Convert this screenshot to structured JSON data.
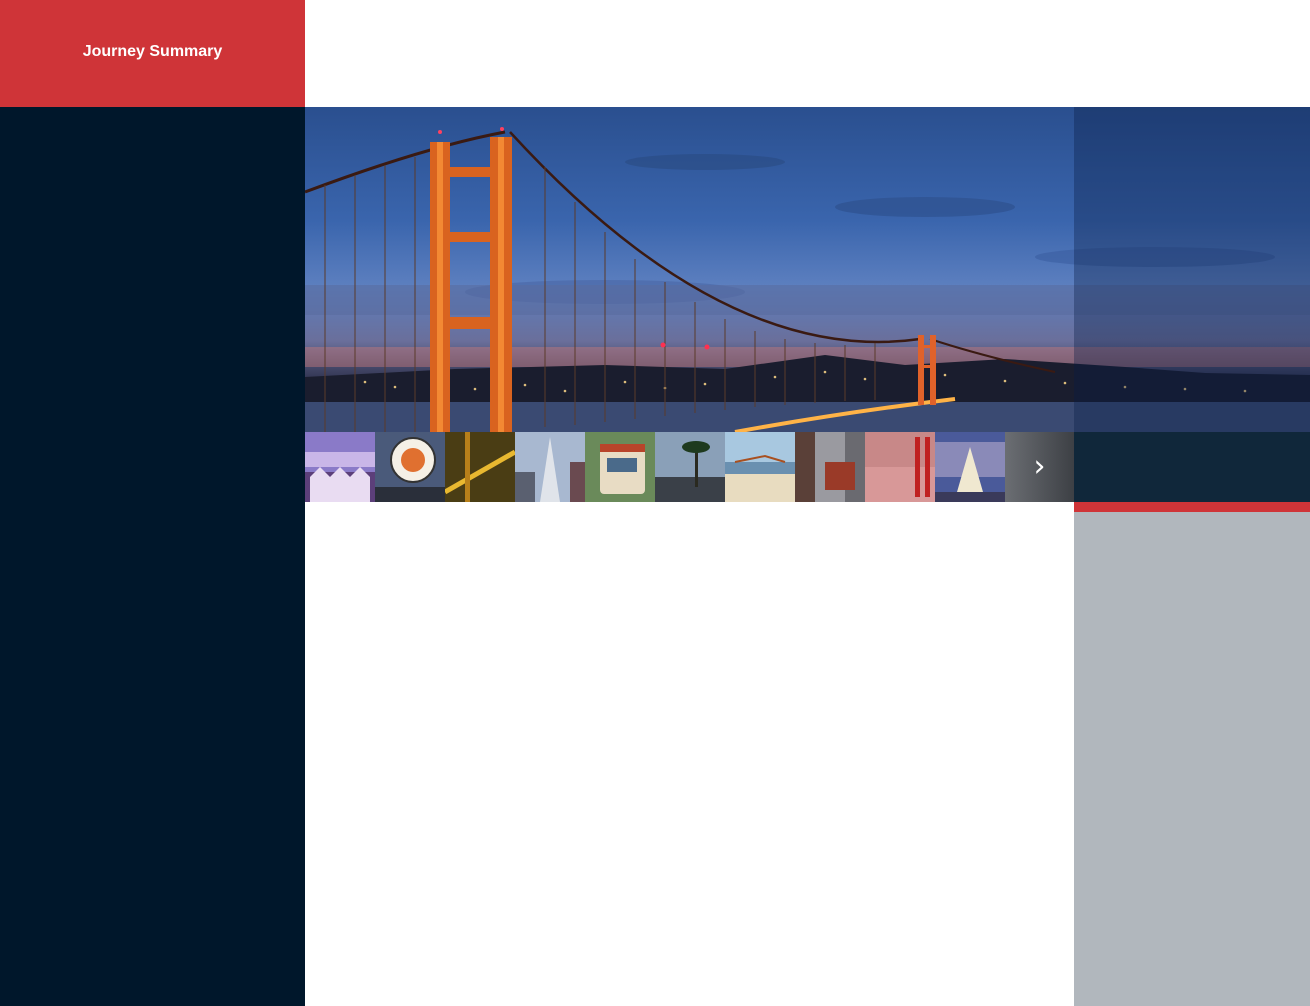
{
  "sidebar": {
    "title": "Journey Summary"
  },
  "hero": {
    "image": "golden-gate-bridge-dusk"
  },
  "gallery": {
    "thumbnails": [
      {
        "name": "painted-ladies"
      },
      {
        "name": "fishermans-wharf-sign"
      },
      {
        "name": "golden-gate-night"
      },
      {
        "name": "transamerica-pyramid"
      },
      {
        "name": "cable-car"
      },
      {
        "name": "palm-trees-street"
      },
      {
        "name": "beach-bridge-view"
      },
      {
        "name": "cable-car-street"
      },
      {
        "name": "golden-gate-fog"
      },
      {
        "name": "union-square-tree"
      }
    ],
    "next_icon": "chevron-right-icon"
  },
  "colors": {
    "accent": "#cf3438",
    "sidebar_bg": "#00172b",
    "right_panel_bg": "#b1b7bd"
  }
}
